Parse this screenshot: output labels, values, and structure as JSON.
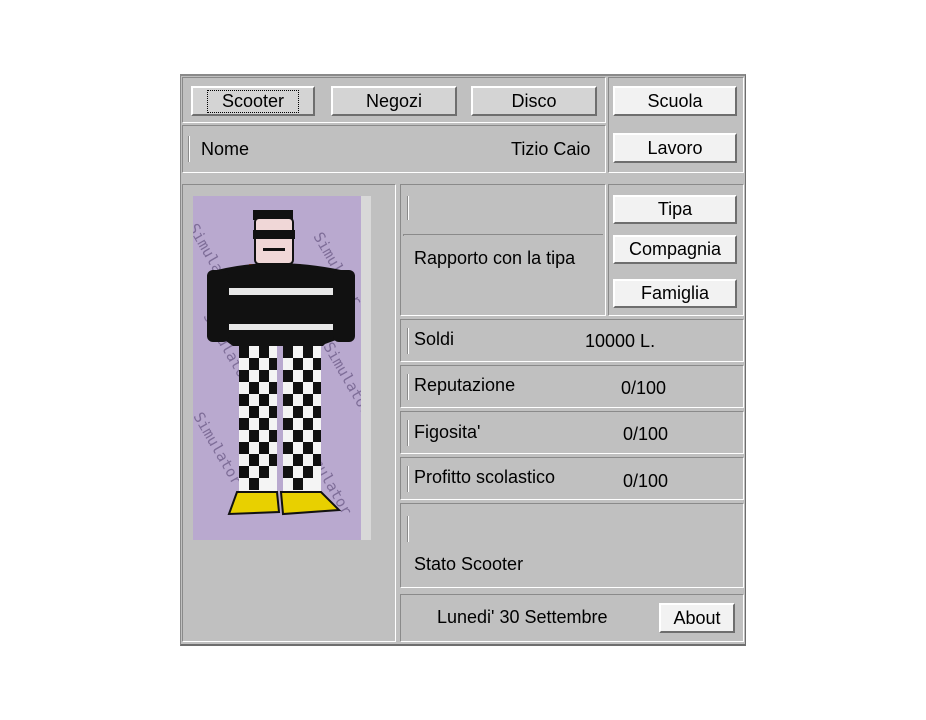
{
  "nav": {
    "scooter": "Scooter",
    "negozi": "Negozi",
    "disco": "Disco",
    "scuola": "Scuola",
    "lavoro": "Lavoro"
  },
  "player": {
    "name_label": "Nome",
    "name_value": "Tizio Caio"
  },
  "relationship": {
    "label": "Rapporto con la tipa",
    "tipa": "Tipa",
    "compagnia": "Compagnia",
    "famiglia": "Famiglia"
  },
  "stats": [
    {
      "label": "Soldi",
      "value": "10000 L."
    },
    {
      "label": "Reputazione",
      "value": "0/100"
    },
    {
      "label": "Figosita'",
      "value": "0/100"
    },
    {
      "label": "Profitto scolastico",
      "value": "0/100"
    }
  ],
  "scooter_status": {
    "label": "Stato Scooter"
  },
  "footer": {
    "date": "Lunedi' 30 Settembre",
    "about": "About"
  },
  "portrait": {
    "watermark": "Simulator",
    "icon": "character-portrait"
  },
  "colors": {
    "window": "#c0c0c0",
    "portrait_bg": "#b9a9cf",
    "jacket": "#111111",
    "shoes": "#e8d000"
  }
}
